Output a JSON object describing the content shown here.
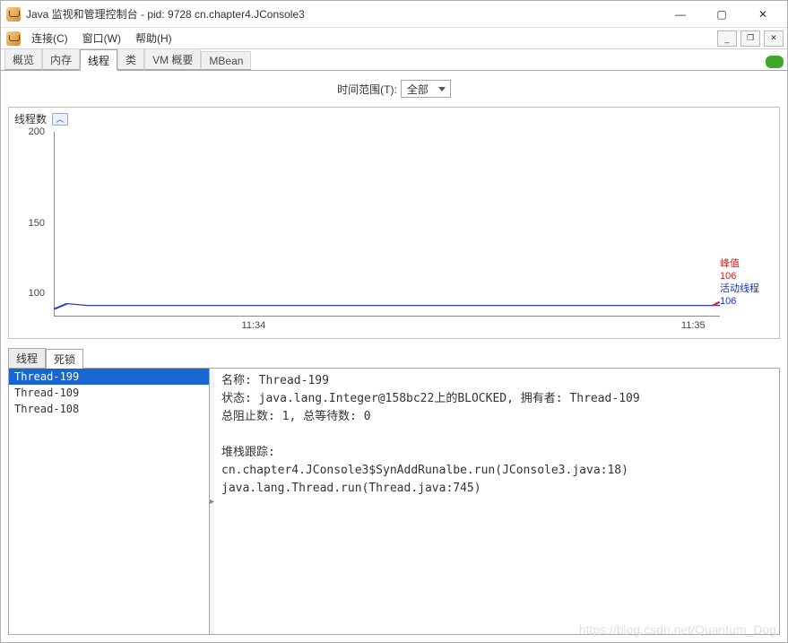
{
  "window": {
    "title": "Java 监视和管理控制台 - pid: 9728 cn.chapter4.JConsole3"
  },
  "menubar": {
    "items": [
      "连接(C)",
      "窗口(W)",
      "帮助(H)"
    ]
  },
  "main_tabs": {
    "items": [
      "概览",
      "内存",
      "线程",
      "类",
      "VM 概要",
      "MBean"
    ],
    "active_index": 2
  },
  "timerange": {
    "label": "时间范围(T):",
    "value": "全部"
  },
  "chart": {
    "title": "线程数",
    "y_ticks": [
      100,
      150,
      200
    ],
    "x_ticks": [
      "11:34",
      "11:35"
    ],
    "legend": {
      "peak_label": "峰值",
      "peak_value": "106",
      "live_label": "活动线程",
      "live_value": "106"
    }
  },
  "chart_data": {
    "type": "line",
    "title": "线程数",
    "xlabel": "",
    "ylabel": "",
    "ylim": [
      100,
      200
    ],
    "x_ticks": [
      "11:34",
      "11:35"
    ],
    "series": [
      {
        "name": "活动线程",
        "x": [
          "11:34",
          "11:35"
        ],
        "values": [
          106,
          106
        ]
      }
    ],
    "annotations": {
      "峰值": 106,
      "活动线程": 106
    }
  },
  "bottom_tabs": {
    "items": [
      "线程",
      "死锁"
    ],
    "active_index": 1
  },
  "thread_list": {
    "items": [
      "Thread-199",
      "Thread-109",
      "Thread-108"
    ],
    "selected_index": 0
  },
  "detail": {
    "name_label": "名称:",
    "name_value": "Thread-199",
    "state_label": "状态:",
    "state_value": "java.lang.Integer@158bc22上的BLOCKED, 拥有者: Thread-109",
    "blocked_label": "总阻止数:",
    "blocked_value": "1,",
    "waited_label": "总等待数:",
    "waited_value": "0",
    "stack_label": "堆栈跟踪:",
    "stack_lines": [
      "cn.chapter4.JConsole3$SynAddRunalbe.run(JConsole3.java:18)",
      "java.lang.Thread.run(Thread.java:745)"
    ]
  },
  "watermark": "https://blog.csdn.net/Quantum_Dog"
}
